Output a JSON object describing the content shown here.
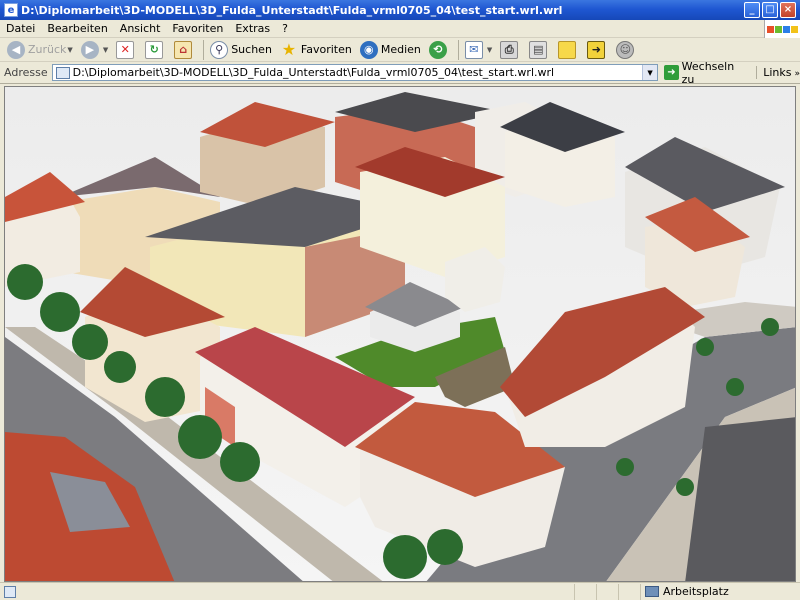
{
  "window": {
    "title": "D:\\Diplomarbeit\\3D-MODELL\\3D_Fulda_Unterstadt\\Fulda_vrml0705_04\\test_start.wrl.wrl",
    "minimize_glyph": "_",
    "maximize_glyph": "□",
    "close_glyph": "×"
  },
  "menu": {
    "items": [
      "Datei",
      "Bearbeiten",
      "Ansicht",
      "Favoriten",
      "Extras",
      "?"
    ]
  },
  "toolbar": {
    "back_label": "Zurück",
    "search_label": "Suchen",
    "favorites_label": "Favoriten",
    "media_label": "Medien"
  },
  "address": {
    "label": "Adresse",
    "value": "D:\\Diplomarbeit\\3D-MODELL\\3D_Fulda_Unterstadt\\Fulda_vrml0705_04\\test_start.wrl.wrl",
    "go_label": "Wechseln zu",
    "links_label": "Links"
  },
  "status": {
    "zone_label": "Arbeitsplatz"
  },
  "colors": {
    "titlebar": "#1f57d2",
    "chrome": "#ece9d8",
    "roof_red": "#b94a35",
    "lawn_green": "#4f8a2a"
  }
}
